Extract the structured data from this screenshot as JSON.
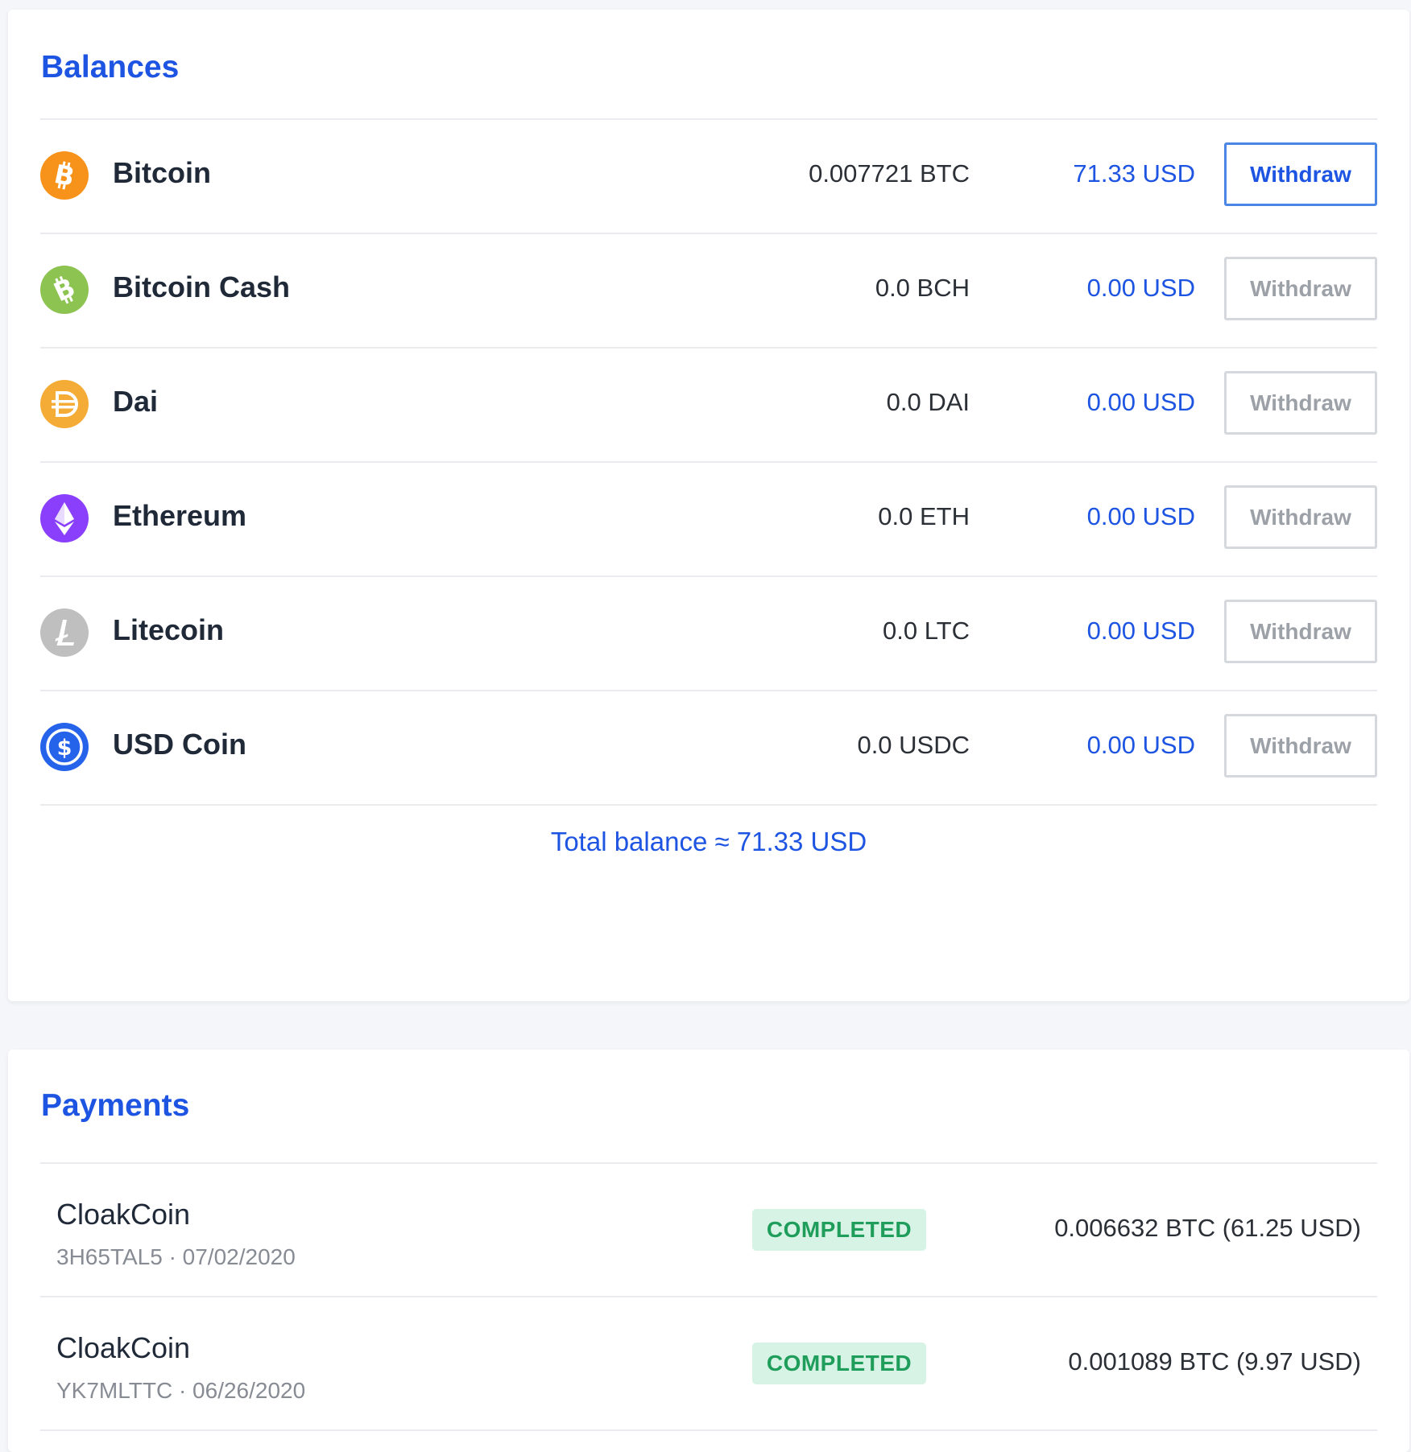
{
  "balances": {
    "title": "Balances",
    "items": [
      {
        "name": "Bitcoin",
        "amount": "0.007721 BTC",
        "usd": "71.33 USD",
        "button": "Withdraw",
        "icon": "bitcoin-icon",
        "color": "#f7931a",
        "active": true
      },
      {
        "name": "Bitcoin Cash",
        "amount": "0.0 BCH",
        "usd": "0.00 USD",
        "button": "Withdraw",
        "icon": "bitcoin-cash-icon",
        "color": "#8dc351",
        "active": false
      },
      {
        "name": "Dai",
        "amount": "0.0 DAI",
        "usd": "0.00 USD",
        "button": "Withdraw",
        "icon": "dai-icon",
        "color": "#f5ac37",
        "active": false
      },
      {
        "name": "Ethereum",
        "amount": "0.0 ETH",
        "usd": "0.00 USD",
        "button": "Withdraw",
        "icon": "ethereum-icon",
        "color": "#8a3ffc",
        "active": false
      },
      {
        "name": "Litecoin",
        "amount": "0.0 LTC",
        "usd": "0.00 USD",
        "button": "Withdraw",
        "icon": "litecoin-icon",
        "color": "#bfbfbf",
        "active": false
      },
      {
        "name": "USD Coin",
        "amount": "0.0 USDC",
        "usd": "0.00 USD",
        "button": "Withdraw",
        "icon": "usd-coin-icon",
        "color": "#2563eb",
        "active": false
      }
    ],
    "total": "Total balance ≈ 71.33 USD"
  },
  "payments": {
    "title": "Payments",
    "items": [
      {
        "name": "CloakCoin",
        "meta": "3H65TAL5 · 07/02/2020",
        "status": "COMPLETED",
        "amount": "0.006632 BTC (61.25 USD)"
      },
      {
        "name": "CloakCoin",
        "meta": "YK7MLTTC · 06/26/2020",
        "status": "COMPLETED",
        "amount": "0.001089 BTC (9.97 USD)"
      }
    ]
  },
  "colors": {
    "accent": "#1d54e2",
    "status_completed_bg": "#d7f3e5",
    "status_completed_text": "#1f9d5a"
  }
}
